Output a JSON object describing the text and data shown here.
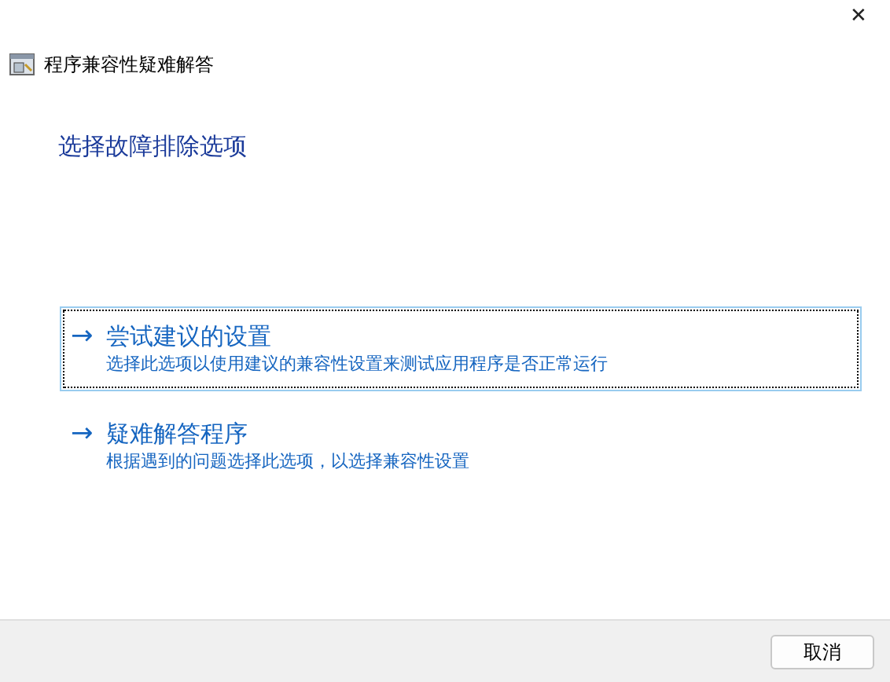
{
  "window": {
    "title": "程序兼容性疑难解答",
    "close": "✕"
  },
  "heading": "选择故障排除选项",
  "options": [
    {
      "title": "尝试建议的设置",
      "description": "选择此选项以使用建议的兼容性设置来测试应用程序是否正常运行",
      "arrow": "→",
      "selected": true
    },
    {
      "title": "疑难解答程序",
      "description": "根据遇到的问题选择此选项，以选择兼容性设置",
      "arrow": "→",
      "selected": false
    }
  ],
  "buttons": [
    "取消"
  ]
}
